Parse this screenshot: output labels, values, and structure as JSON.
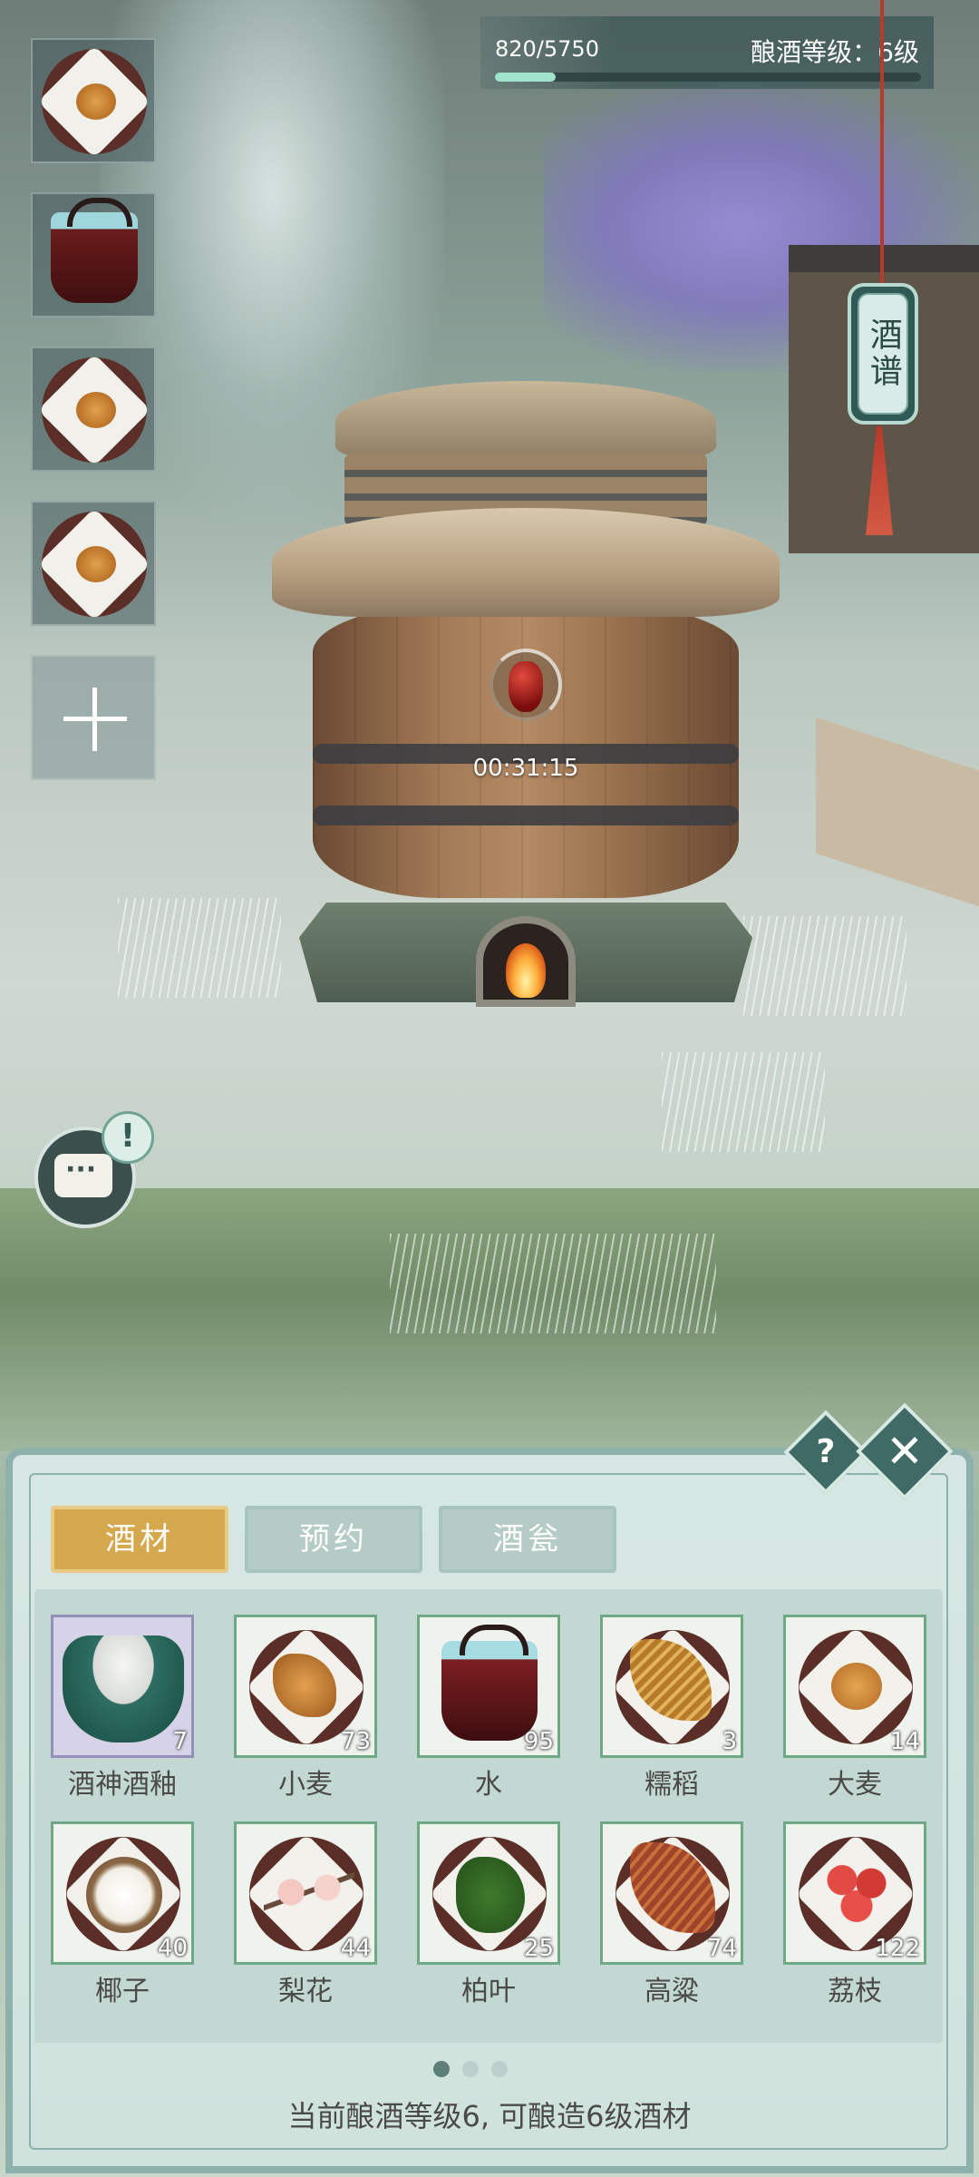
{
  "hud": {
    "xp_text": "820/5750",
    "xp_progress": 0.143,
    "level_text": "酿酒等级：6级"
  },
  "recipe_button": {
    "label": "酒谱"
  },
  "barrel": {
    "timer": "00:31:15"
  },
  "left_slots": [
    {
      "icon": "barley-dish-icon"
    },
    {
      "icon": "water-bucket-icon"
    },
    {
      "icon": "barley-dish-icon"
    },
    {
      "icon": "barley-dish-icon"
    }
  ],
  "panel": {
    "tabs": [
      {
        "label": "酒材",
        "active": true
      },
      {
        "label": "预约",
        "active": false
      },
      {
        "label": "酒瓮",
        "active": false
      }
    ],
    "help_label": "?",
    "close_label": "✕",
    "items": [
      {
        "name": "酒神酒釉",
        "count": "7",
        "icon": "yeast-bowl-icon",
        "selected": true
      },
      {
        "name": "小麦",
        "count": "73",
        "icon": "wheat-icon"
      },
      {
        "name": "水",
        "count": "95",
        "icon": "water-bucket-icon"
      },
      {
        "name": "糯稻",
        "count": "3",
        "icon": "glutinous-rice-icon"
      },
      {
        "name": "大麦",
        "count": "14",
        "icon": "barley-icon"
      },
      {
        "name": "椰子",
        "count": "40",
        "icon": "coconut-icon"
      },
      {
        "name": "梨花",
        "count": "44",
        "icon": "pear-blossom-icon"
      },
      {
        "name": "柏叶",
        "count": "25",
        "icon": "cypress-leaf-icon"
      },
      {
        "name": "高粱",
        "count": "74",
        "icon": "sorghum-icon"
      },
      {
        "name": "荔枝",
        "count": "122",
        "icon": "lychee-icon"
      }
    ],
    "page_dots": [
      true,
      false,
      false
    ],
    "footer": "当前酿酒等级6, 可酿造6级酒材"
  },
  "colors": {
    "active_tab": "#d6a84d",
    "inactive_tab": "#b5ccc6",
    "panel_bg": "#d7e8e4",
    "item_border": "#6fa886"
  }
}
